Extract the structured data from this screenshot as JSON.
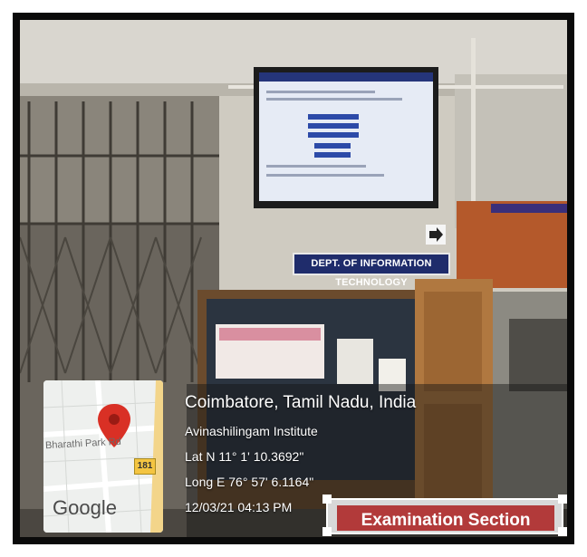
{
  "location": {
    "city": "Coimbatore, Tamil Nadu, India",
    "place": "Avinashilingam Institute",
    "lat": "Lat N 11° 1' 10.3692\"",
    "long": "Long E 76° 57' 6.1164\"",
    "timestamp": "12/03/21 04:13 PM"
  },
  "map": {
    "road_label": "Bharathi Park Rd",
    "route_number": "181",
    "brand": "Google"
  },
  "sign": {
    "text": "DEPT. OF INFORMATION TECHNOLOGY"
  },
  "caption": {
    "text": "Examination Section"
  },
  "colors": {
    "caption_bg": "#b23a3a",
    "sign_bg": "#1f2c6b",
    "pin": "#d93025"
  }
}
